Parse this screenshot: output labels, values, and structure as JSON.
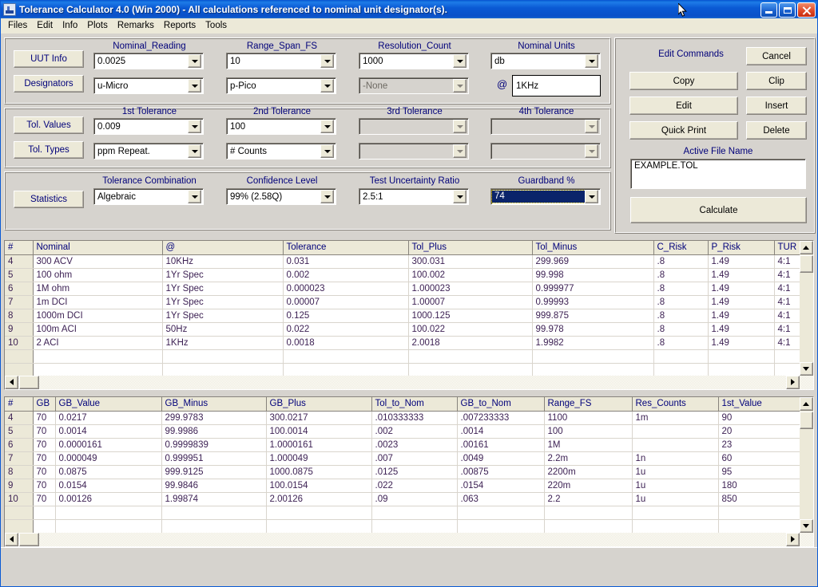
{
  "window": {
    "title": "Tolerance Calculator 4.0 (Win 2000) - All calculations referenced to nominal unit designator(s).",
    "icon": "app-icon",
    "buttons": {
      "minimize": "minimize-icon",
      "restore": "restore-icon",
      "close": "close-icon"
    }
  },
  "menubar": {
    "items": [
      "Files",
      "Edit",
      "Info",
      "Plots",
      "Remarks",
      "Reports",
      "Tools"
    ]
  },
  "form": {
    "group1": {
      "buttons": [
        "UUT Info",
        "Designators"
      ],
      "columns": [
        {
          "label": "Nominal_Reading",
          "value": "0.0025",
          "value2": "u-Micro",
          "disabled2": false
        },
        {
          "label": "Range_Span_FS",
          "value": "10",
          "value2": "p-Pico",
          "disabled2": false
        },
        {
          "label": "Resolution_Count",
          "value": "1000",
          "value2": "-None",
          "disabled2": true
        },
        {
          "label": "Nominal Units",
          "value": "db",
          "at_label": "@",
          "at_value": "1KHz"
        }
      ]
    },
    "group2": {
      "buttons": [
        "Tol. Values",
        "Tol. Types"
      ],
      "columns": [
        {
          "label": "1st Tolerance",
          "value": "0.009",
          "value2": "ppm Repeat.",
          "disabled": false
        },
        {
          "label": "2nd Tolerance",
          "value": "100",
          "value2": "# Counts",
          "disabled": false
        },
        {
          "label": "3rd Tolerance",
          "value": "",
          "value2": "",
          "disabled": true
        },
        {
          "label": "4th Tolerance",
          "value": "",
          "value2": "",
          "disabled": true
        }
      ]
    },
    "group3": {
      "buttons": [
        "Statistics"
      ],
      "columns": [
        {
          "label": "Tolerance Combination",
          "value": "Algebraic"
        },
        {
          "label": "Confidence Level",
          "value": "99%   (2.58Q)"
        },
        {
          "label": "Test Uncertainty Ratio",
          "value": "2.5:1"
        },
        {
          "label": "Guardband %",
          "value": "74",
          "focused": true
        }
      ]
    }
  },
  "commands": {
    "title": "Edit Commands",
    "cancel": "Cancel",
    "copy": "Copy",
    "clip": "Clip",
    "edit": "Edit",
    "insert": "Insert",
    "quick_print": "Quick Print",
    "delete": "Delete",
    "file_label": "Active File Name",
    "file_name": "EXAMPLE.TOL",
    "calculate": "Calculate"
  },
  "grid_top": {
    "columns": [
      "#",
      "Nominal",
      "@",
      "Tolerance",
      "Tol_Plus",
      "Tol_Minus",
      "C_Risk",
      "P_Risk",
      "TUR"
    ],
    "rows": [
      [
        "4",
        "300 ACV",
        "10KHz",
        "0.031",
        "300.031",
        "299.969",
        ".8",
        "1.49",
        "4:1"
      ],
      [
        "5",
        "100 ohm",
        "1Yr Spec",
        "0.002",
        "100.002",
        "99.998",
        ".8",
        "1.49",
        "4:1"
      ],
      [
        "6",
        "1M ohm",
        "1Yr Spec",
        "0.000023",
        "1.000023",
        "0.999977",
        ".8",
        "1.49",
        "4:1"
      ],
      [
        "7",
        "1m DCI",
        "1Yr Spec",
        "0.00007",
        "1.00007",
        "0.99993",
        ".8",
        "1.49",
        "4:1"
      ],
      [
        "8",
        "1000m DCI",
        "1Yr Spec",
        "0.125",
        "1000.125",
        "999.875",
        ".8",
        "1.49",
        "4:1"
      ],
      [
        "9",
        "100m ACI",
        "50Hz",
        "0.022",
        "100.022",
        "99.978",
        ".8",
        "1.49",
        "4:1"
      ],
      [
        "10",
        "2 ACI",
        "1KHz",
        "0.0018",
        "2.0018",
        "1.9982",
        ".8",
        "1.49",
        "4:1"
      ],
      [
        "",
        "",
        "",
        "",
        "",
        "",
        "",
        "",
        ""
      ],
      [
        "",
        "",
        "",
        "",
        "",
        "",
        "",
        "",
        ""
      ]
    ]
  },
  "grid_bottom": {
    "columns": [
      "#",
      "GB",
      "GB_Value",
      "GB_Minus",
      "GB_Plus",
      "Tol_to_Nom",
      "GB_to_Nom",
      "Range_FS",
      "Res_Counts",
      "1st_Value"
    ],
    "rows": [
      [
        "4",
        "70",
        "0.0217",
        "299.9783",
        "300.0217",
        ".010333333",
        ".007233333",
        "1100",
        "1m",
        "90"
      ],
      [
        "5",
        "70",
        "0.0014",
        "99.9986",
        "100.0014",
        ".002",
        ".0014",
        "100",
        "",
        "20"
      ],
      [
        "6",
        "70",
        "0.0000161",
        "0.9999839",
        "1.0000161",
        ".0023",
        ".00161",
        "1M",
        "",
        "23"
      ],
      [
        "7",
        "70",
        "0.000049",
        "0.999951",
        "1.000049",
        ".007",
        ".0049",
        "2.2m",
        "1n",
        "60"
      ],
      [
        "8",
        "70",
        "0.0875",
        "999.9125",
        "1000.0875",
        ".0125",
        ".00875",
        "2200m",
        "1u",
        "95"
      ],
      [
        "9",
        "70",
        "0.0154",
        "99.9846",
        "100.0154",
        ".022",
        ".0154",
        "220m",
        "1u",
        "180"
      ],
      [
        "10",
        "70",
        "0.00126",
        "1.99874",
        "2.00126",
        ".09",
        ".063",
        "2.2",
        "1u",
        "850"
      ],
      [
        "",
        "",
        "",
        "",
        "",
        "",
        "",
        "",
        "",
        ""
      ],
      [
        "",
        "",
        "",
        "",
        "",
        "",
        "",
        "",
        "",
        ""
      ]
    ]
  },
  "scrollbars": {
    "up": "scroll-up-icon",
    "down": "scroll-down-icon",
    "left": "scroll-left-icon",
    "right": "scroll-right-icon"
  },
  "colors": {
    "accent": "#00007a",
    "titlebar": "#0a5ad4",
    "face": "#d6d3ce",
    "button": "#ece9d8",
    "select": "#0a246a"
  }
}
